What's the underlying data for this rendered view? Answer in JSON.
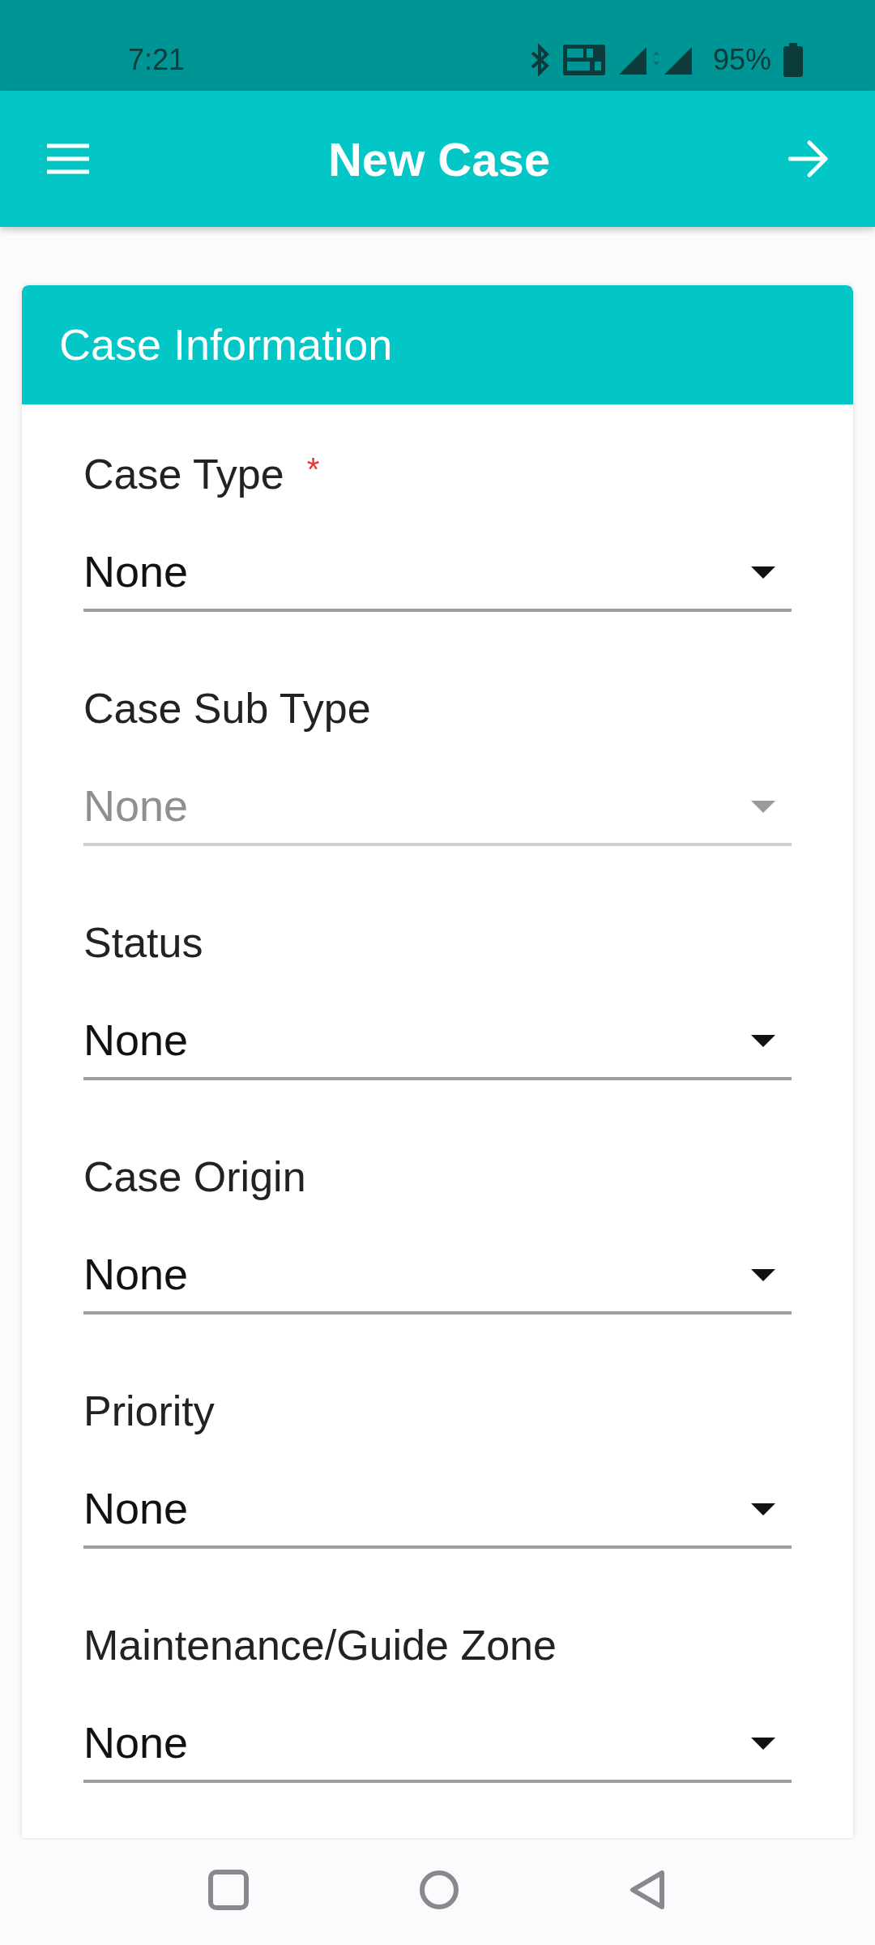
{
  "status_bar": {
    "time": "7:21",
    "battery": "95%"
  },
  "app_bar": {
    "title": "New Case"
  },
  "card": {
    "title": "Case Information",
    "fields": [
      {
        "label": "Case Type",
        "required_mark": "*",
        "value": "None",
        "disabled": false
      },
      {
        "label": "Case Sub Type",
        "value": "None",
        "disabled": true
      },
      {
        "label": "Status",
        "value": "None",
        "disabled": false
      },
      {
        "label": "Case Origin",
        "value": "None",
        "disabled": false
      },
      {
        "label": "Priority",
        "value": "None",
        "disabled": false
      },
      {
        "label": "Maintenance/Guide Zone",
        "value": "None",
        "disabled": false
      }
    ]
  }
}
